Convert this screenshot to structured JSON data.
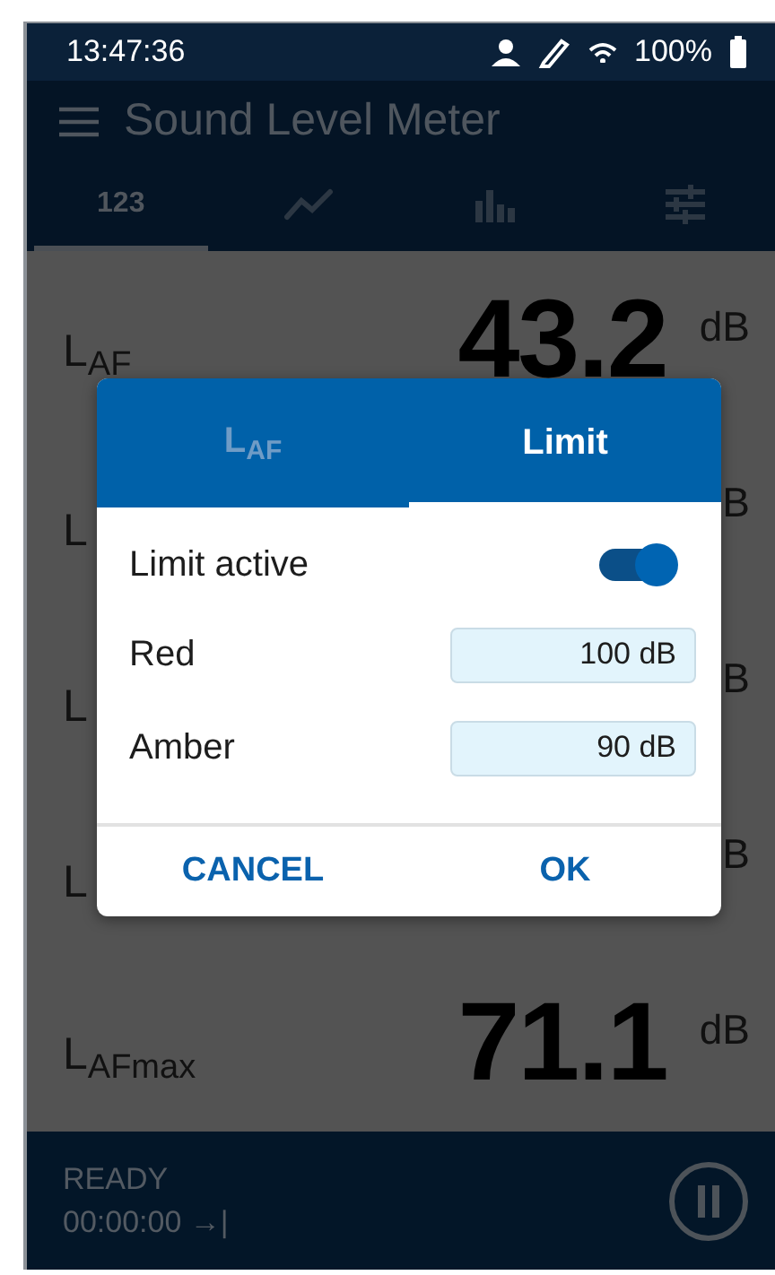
{
  "status_bar": {
    "time": "13:47:36",
    "battery": "100%"
  },
  "app_bar": {
    "title": "Sound Level Meter"
  },
  "tabs": [
    {
      "kind": "numbers",
      "label": "123",
      "selected": true
    },
    {
      "kind": "trend",
      "selected": false
    },
    {
      "kind": "spectrum",
      "selected": false
    },
    {
      "kind": "settings",
      "selected": false
    }
  ],
  "measurements": [
    {
      "label": "L$_{AF}$",
      "value": "43.2",
      "unit": "dB"
    },
    {
      "label": "L",
      "unit": "B"
    },
    {
      "label": "L",
      "unit": "B"
    },
    {
      "label": "L",
      "unit": "B"
    },
    {
      "label": "L$_{AFmax}$",
      "value": "71.1",
      "unit": "dB"
    }
  ],
  "dialog": {
    "tabs": [
      {
        "label": "L$_{AF}$",
        "selected": false
      },
      {
        "label": "Limit",
        "selected": true
      }
    ],
    "toggle": {
      "label": "Limit active",
      "on": true
    },
    "fields": [
      {
        "label": "Red",
        "value": "100 dB"
      },
      {
        "label": "Amber",
        "value": "90 dB"
      }
    ],
    "buttons": [
      "CANCEL",
      "OK"
    ]
  },
  "footer": {
    "state": "READY",
    "timer": "00:00:00 →|"
  }
}
